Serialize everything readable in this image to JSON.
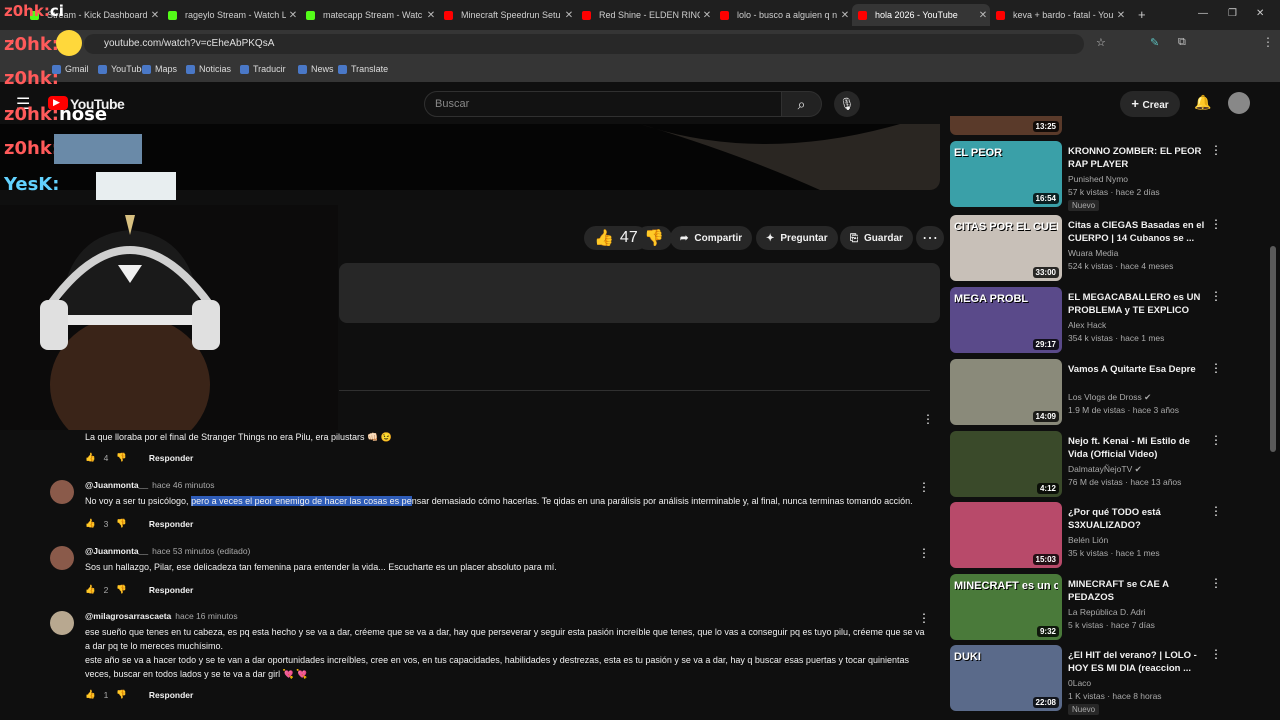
{
  "browser": {
    "tabs": [
      {
        "title": "Stream - Kick Dashboard",
        "color": "#53fc18"
      },
      {
        "title": "rageylo Stream - Watch Li",
        "color": "#53fc18"
      },
      {
        "title": "matecapp Stream - Watc",
        "color": "#53fc18"
      },
      {
        "title": "Minecraft Speedrun Setu",
        "color": "#ff0000"
      },
      {
        "title": "Red Shine - ELDEN RING",
        "color": "#ff0000"
      },
      {
        "title": "lolo - busco a alguien q n",
        "color": "#ff0000"
      },
      {
        "title": "hola 2026 - YouTube",
        "color": "#ff0000"
      },
      {
        "title": "keva + bardo - fatal - You",
        "color": "#ff0000"
      }
    ],
    "url": "youtube.com/watch?v=cEheAbPKQsA",
    "bookmarks": [
      "Gmail",
      "YouTube",
      "Maps",
      "Noticias",
      "Traducir",
      "News",
      "Translate"
    ]
  },
  "header": {
    "logo": "YouTube",
    "search_placeholder": "Buscar",
    "create_label": "Crear"
  },
  "overlay": {
    "chat": [
      {
        "user": "z0hk:",
        "msg": "ci"
      },
      {
        "user": "z0hk:",
        "msg": ""
      },
      {
        "user": "z0hk:",
        "msg": ""
      },
      {
        "user": "z0hk:",
        "msg": "nose"
      },
      {
        "user": "z0hk:",
        "msg": ""
      },
      {
        "user": "YesK:",
        "msg": ""
      }
    ]
  },
  "actions": {
    "likes": "47",
    "share": "Compartir",
    "ask": "Preguntar",
    "save": "Guardar"
  },
  "comments": [
    {
      "author": "",
      "time": "",
      "text": "La que lloraba por el final de Stranger Things no era Pilu, era pilustars 👊🏻 😉",
      "likes": "4",
      "reply": "Responder"
    },
    {
      "author": "@Juanmonta__",
      "time": "hace 46 minutos",
      "text_pre": "No voy a ser tu psicólogo, ",
      "text_hl": "pero a veces el peor enemigo de hacer las cosas es pe",
      "text_post": "nsar demasiado cómo hacerlas. Te qidas en una parálisis por análisis interminable y, al final, nunca terminas tomando acción.",
      "likes": "3",
      "reply": "Responder"
    },
    {
      "author": "@Juanmonta__",
      "time": "hace 53 minutos (editado)",
      "text": "Sos un hallazgo, Pilar, ese delicadeza tan femenina para entender la vida... Escucharte es un placer absoluto para mí.",
      "likes": "2",
      "reply": "Responder"
    },
    {
      "author": "@milagrosarrascaeta",
      "time": "hace 16 minutos",
      "lines": [
        "ese sueño que tenes en tu cabeza, es pq esta hecho y se va a dar, créeme que se va a dar, hay que perseverar y seguir esta pasión increíble que tenes, que lo vas a conseguir pq es tuyo pilu, créeme que se va",
        "a dar pq te lo mereces muchísimo.",
        "este año se va a hacer todo y se te van a dar oportunidades increíbles, cree en vos, en tus capacidades, habilidades y destrezas, esta es tu pasión y se va a dar, hay q buscar esas puertas y tocar quinientas",
        "veces,  buscar en todos lados y se te va a dar girl 💘 💘"
      ],
      "likes": "1",
      "reply": "Responder"
    }
  ],
  "sidebar": [
    {
      "title": "",
      "channel": "",
      "meta": "",
      "duration": "13:25",
      "color": "#5a3a2a"
    },
    {
      "title": "KRONNO ZOMBER: EL PEOR RAP PLAYER",
      "channel": "Punished Nymo",
      "meta": "57 k vistas · hace 2 días",
      "badge": "Nuevo",
      "duration": "16:54",
      "thumb_text": "EL PEOR",
      "color": "#3aa0a8"
    },
    {
      "title": "Citas a CIEGAS Basadas en el CUERPO | 14 Cubanos se ...",
      "channel": "Wuara Media",
      "meta": "524 k vistas · hace 4 meses",
      "duration": "33:00",
      "thumb_text": "CITAS POR EL CUERPO",
      "color": "#c8c0b8"
    },
    {
      "title": "EL MEGACABALLERO es UN PROBLEMA y TE EXPLICO PO...",
      "channel": "Alex Hack",
      "meta": "354 k vistas · hace 1 mes",
      "duration": "29:17",
      "thumb_text": "MEGA PROBL",
      "color": "#5a4a8a"
    },
    {
      "title": "Vamos A Quitarte Esa Depre",
      "channel": "Los Vlogs de Dross",
      "meta": "1.9 M de vistas · hace 3 años",
      "duration": "14:09",
      "verified": true,
      "color": "#8a8a7a"
    },
    {
      "title": "Nejo ft. Kenai - Mi Estilo de Vida (Official Video)",
      "channel": "DalmatayÑejoTV",
      "meta": "76 M de vistas · hace 13 años",
      "duration": "4:12",
      "verified": true,
      "color": "#3a4a2a"
    },
    {
      "title": "¿Por qué TODO está S3XUALIZADO?",
      "channel": "Belén Lión",
      "meta": "35 k vistas · hace 1 mes",
      "duration": "15:03",
      "color": "#b84a6a"
    },
    {
      "title": "MINECRAFT se CAE A PEDAZOS",
      "channel": "La República D. Adri",
      "meta": "5 k vistas · hace 7 días",
      "duration": "9:32",
      "thumb_text": "MINECRAFT es un caos",
      "color": "#4a7a3a"
    },
    {
      "title": "¿El HIT del verano? | LOLO - HOY ES MI DIA (reaccion ...",
      "channel": "0Laco",
      "meta": "1 K vistas · hace 8 horas",
      "badge": "Nuevo",
      "duration": "22:08",
      "thumb_text": "DUKI",
      "color": "#5a6a8a"
    }
  ]
}
